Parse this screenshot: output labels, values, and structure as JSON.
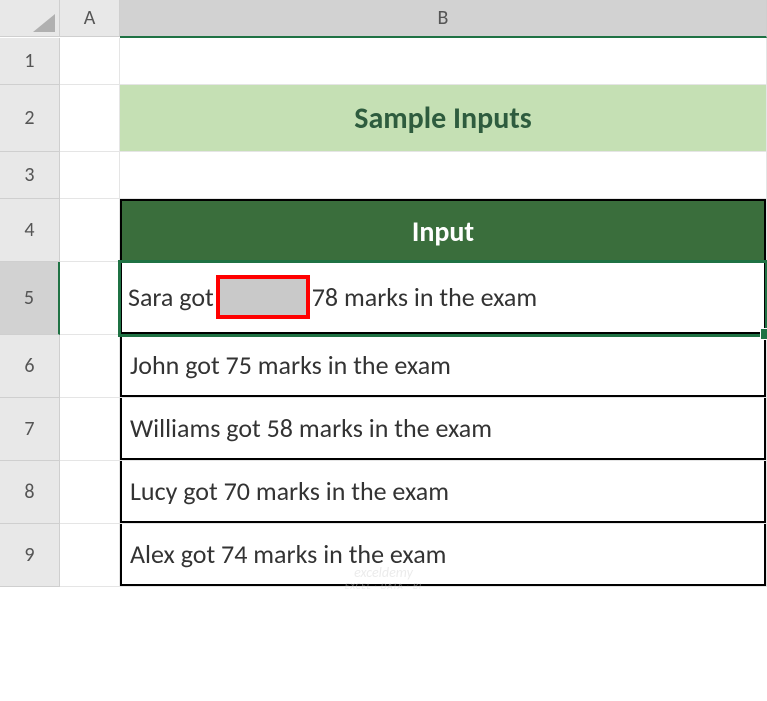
{
  "columns": {
    "A": "A",
    "B": "B"
  },
  "rows": [
    "1",
    "2",
    "3",
    "4",
    "5",
    "6",
    "7",
    "8",
    "9"
  ],
  "title": "Sample Inputs",
  "table_header": "Input",
  "chart_data": {
    "type": "table",
    "title": "Sample Inputs",
    "columns": [
      "Input"
    ],
    "rows": [
      "Sara got 78 marks in the exam",
      "John got 75 marks in the exam",
      "Williams got 58 marks in the exam",
      "Lucy got 70 marks in the exam",
      "Alex got 74 marks in the exam"
    ]
  },
  "b5": {
    "before": "Sara got",
    "after": "78 marks in the exam"
  },
  "watermark": {
    "line1": "exceldemy",
    "line2": "EXCEL · DATA · BI"
  }
}
